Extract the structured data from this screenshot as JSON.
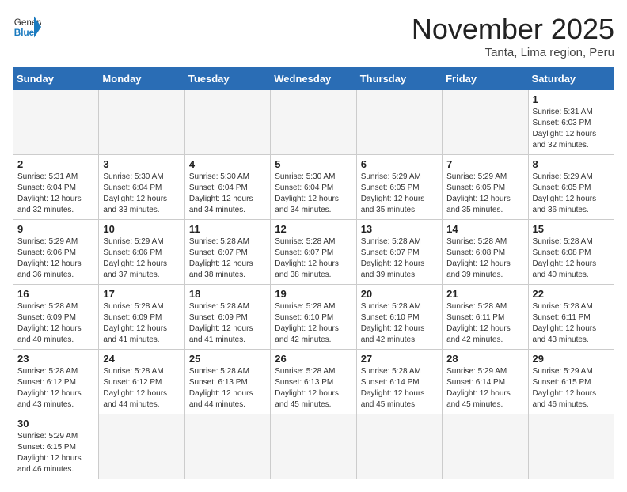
{
  "header": {
    "logo_general": "General",
    "logo_blue": "Blue",
    "month_title": "November 2025",
    "location": "Tanta, Lima region, Peru"
  },
  "weekdays": [
    "Sunday",
    "Monday",
    "Tuesday",
    "Wednesday",
    "Thursday",
    "Friday",
    "Saturday"
  ],
  "days": {
    "d1": {
      "num": "1",
      "sunrise": "5:31 AM",
      "sunset": "6:03 PM",
      "daylight": "12 hours and 32 minutes."
    },
    "d2": {
      "num": "2",
      "sunrise": "5:31 AM",
      "sunset": "6:04 PM",
      "daylight": "12 hours and 32 minutes."
    },
    "d3": {
      "num": "3",
      "sunrise": "5:30 AM",
      "sunset": "6:04 PM",
      "daylight": "12 hours and 33 minutes."
    },
    "d4": {
      "num": "4",
      "sunrise": "5:30 AM",
      "sunset": "6:04 PM",
      "daylight": "12 hours and 34 minutes."
    },
    "d5": {
      "num": "5",
      "sunrise": "5:30 AM",
      "sunset": "6:04 PM",
      "daylight": "12 hours and 34 minutes."
    },
    "d6": {
      "num": "6",
      "sunrise": "5:29 AM",
      "sunset": "6:05 PM",
      "daylight": "12 hours and 35 minutes."
    },
    "d7": {
      "num": "7",
      "sunrise": "5:29 AM",
      "sunset": "6:05 PM",
      "daylight": "12 hours and 35 minutes."
    },
    "d8": {
      "num": "8",
      "sunrise": "5:29 AM",
      "sunset": "6:05 PM",
      "daylight": "12 hours and 36 minutes."
    },
    "d9": {
      "num": "9",
      "sunrise": "5:29 AM",
      "sunset": "6:06 PM",
      "daylight": "12 hours and 36 minutes."
    },
    "d10": {
      "num": "10",
      "sunrise": "5:29 AM",
      "sunset": "6:06 PM",
      "daylight": "12 hours and 37 minutes."
    },
    "d11": {
      "num": "11",
      "sunrise": "5:28 AM",
      "sunset": "6:07 PM",
      "daylight": "12 hours and 38 minutes."
    },
    "d12": {
      "num": "12",
      "sunrise": "5:28 AM",
      "sunset": "6:07 PM",
      "daylight": "12 hours and 38 minutes."
    },
    "d13": {
      "num": "13",
      "sunrise": "5:28 AM",
      "sunset": "6:07 PM",
      "daylight": "12 hours and 39 minutes."
    },
    "d14": {
      "num": "14",
      "sunrise": "5:28 AM",
      "sunset": "6:08 PM",
      "daylight": "12 hours and 39 minutes."
    },
    "d15": {
      "num": "15",
      "sunrise": "5:28 AM",
      "sunset": "6:08 PM",
      "daylight": "12 hours and 40 minutes."
    },
    "d16": {
      "num": "16",
      "sunrise": "5:28 AM",
      "sunset": "6:09 PM",
      "daylight": "12 hours and 40 minutes."
    },
    "d17": {
      "num": "17",
      "sunrise": "5:28 AM",
      "sunset": "6:09 PM",
      "daylight": "12 hours and 41 minutes."
    },
    "d18": {
      "num": "18",
      "sunrise": "5:28 AM",
      "sunset": "6:09 PM",
      "daylight": "12 hours and 41 minutes."
    },
    "d19": {
      "num": "19",
      "sunrise": "5:28 AM",
      "sunset": "6:10 PM",
      "daylight": "12 hours and 42 minutes."
    },
    "d20": {
      "num": "20",
      "sunrise": "5:28 AM",
      "sunset": "6:10 PM",
      "daylight": "12 hours and 42 minutes."
    },
    "d21": {
      "num": "21",
      "sunrise": "5:28 AM",
      "sunset": "6:11 PM",
      "daylight": "12 hours and 42 minutes."
    },
    "d22": {
      "num": "22",
      "sunrise": "5:28 AM",
      "sunset": "6:11 PM",
      "daylight": "12 hours and 43 minutes."
    },
    "d23": {
      "num": "23",
      "sunrise": "5:28 AM",
      "sunset": "6:12 PM",
      "daylight": "12 hours and 43 minutes."
    },
    "d24": {
      "num": "24",
      "sunrise": "5:28 AM",
      "sunset": "6:12 PM",
      "daylight": "12 hours and 44 minutes."
    },
    "d25": {
      "num": "25",
      "sunrise": "5:28 AM",
      "sunset": "6:13 PM",
      "daylight": "12 hours and 44 minutes."
    },
    "d26": {
      "num": "26",
      "sunrise": "5:28 AM",
      "sunset": "6:13 PM",
      "daylight": "12 hours and 45 minutes."
    },
    "d27": {
      "num": "27",
      "sunrise": "5:28 AM",
      "sunset": "6:14 PM",
      "daylight": "12 hours and 45 minutes."
    },
    "d28": {
      "num": "28",
      "sunrise": "5:29 AM",
      "sunset": "6:14 PM",
      "daylight": "12 hours and 45 minutes."
    },
    "d29": {
      "num": "29",
      "sunrise": "5:29 AM",
      "sunset": "6:15 PM",
      "daylight": "12 hours and 46 minutes."
    },
    "d30": {
      "num": "30",
      "sunrise": "5:29 AM",
      "sunset": "6:15 PM",
      "daylight": "12 hours and 46 minutes."
    }
  },
  "labels": {
    "sunrise": "Sunrise:",
    "sunset": "Sunset:",
    "daylight": "Daylight:"
  }
}
